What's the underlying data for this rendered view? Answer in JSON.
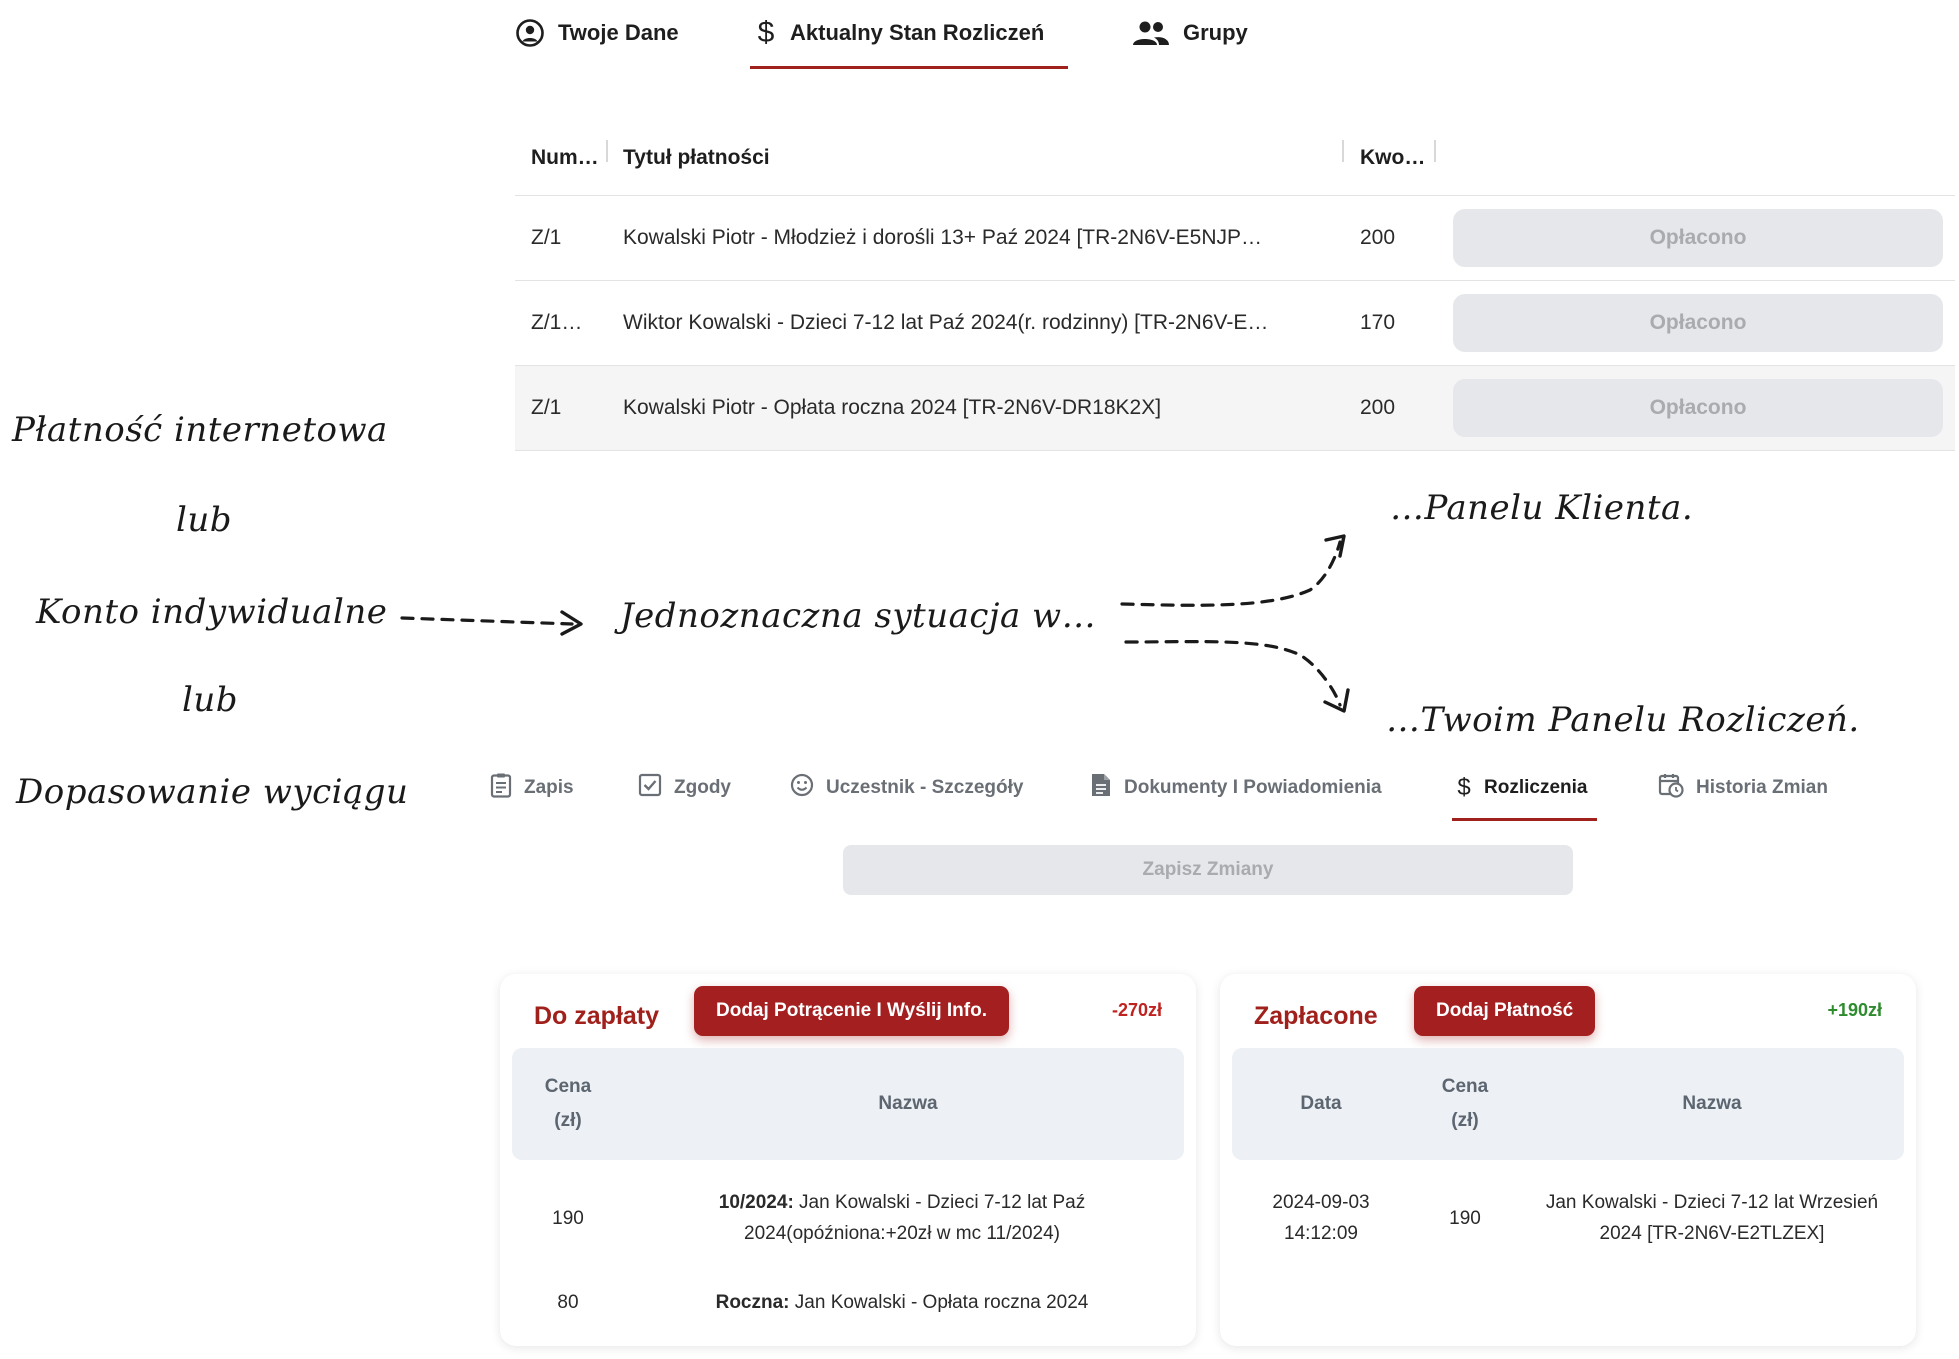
{
  "top_tabs": [
    {
      "label": "Twoje Dane",
      "icon": "user-circle-icon"
    },
    {
      "label": "Aktualny Stan Rozliczeń",
      "icon": "dollar-icon",
      "active": true
    },
    {
      "label": "Grupy",
      "icon": "users-icon"
    }
  ],
  "payments_table": {
    "headers": {
      "number": "Num…",
      "title": "Tytuł płatności",
      "amount": "Kwo…"
    },
    "rows": [
      {
        "number": "Z/1",
        "title": "Kowalski Piotr - Młodzież i dorośli 13+ Paź 2024 [TR-2N6V-E5NJP…",
        "amount": "200",
        "status": "Opłacono"
      },
      {
        "number": "Z/1…",
        "title": "Wiktor Kowalski - Dzieci 7-12 lat Paź 2024(r. rodzinny) [TR-2N6V-E…",
        "amount": "170",
        "status": "Opłacono"
      },
      {
        "number": "Z/1",
        "title": "Kowalski Piotr - Opłata roczna 2024 [TR-2N6V-DR18K2X]",
        "amount": "200",
        "status": "Opłacono"
      }
    ]
  },
  "annotations": {
    "source_1": "Płatność internetowa",
    "or_1": "lub",
    "source_2": "Konto indywidualne",
    "or_2": "lub",
    "source_3": "Dopasowanie wyciągu",
    "middle": "Jednoznaczna sytuacja w…",
    "target_1": "…Panelu Klienta.",
    "target_2": "…Twoim Panelu Rozliczeń."
  },
  "bottom_tabs": [
    {
      "label": "Zapis",
      "icon": "clipboard-icon"
    },
    {
      "label": "Zgody",
      "icon": "checkbox-icon"
    },
    {
      "label": "Uczestnik - Szczegóły",
      "icon": "smiley-icon"
    },
    {
      "label": "Dokumenty I Powiadomienia",
      "icon": "document-icon"
    },
    {
      "label": "Rozliczenia",
      "icon": "dollar-icon",
      "active": true
    },
    {
      "label": "Historia Zmian",
      "icon": "calendar-clock-icon"
    }
  ],
  "save_button": "Zapisz Zmiany",
  "due_card": {
    "title": "Do zapłaty",
    "action": "Dodaj Potrącenie I Wyślij Info.",
    "total": "-270zł",
    "total_color": "#c0231f",
    "headers": {
      "price_1": "Cena",
      "price_2": "(zł)",
      "name": "Nazwa"
    },
    "rows": [
      {
        "price": "190",
        "name_bold": "10/2024:",
        "name": " Jan Kowalski - Dzieci 7-12 lat Paź 2024(opóźniona:+20zł w mc 11/2024)"
      },
      {
        "price": "80",
        "name_bold": "Roczna:",
        "name": " Jan Kowalski - Opłata roczna 2024"
      }
    ]
  },
  "paid_card": {
    "title": "Zapłacone",
    "action": "Dodaj Płatność",
    "total": "+190zł",
    "total_color": "#2e8b2e",
    "headers": {
      "date": "Data",
      "price_1": "Cena",
      "price_2": "(zł)",
      "name": "Nazwa"
    },
    "rows": [
      {
        "date": "2024-09-03",
        "time": "14:12:09",
        "price": "190",
        "name": "Jan Kowalski - Dzieci 7-12 lat Wrzesień 2024 [TR-2N6V-E2TLZEX]"
      }
    ]
  },
  "colors": {
    "accent": "#a0201c",
    "disabled_bg": "#e5e7ea",
    "disabled_text": "#a9abaf"
  }
}
